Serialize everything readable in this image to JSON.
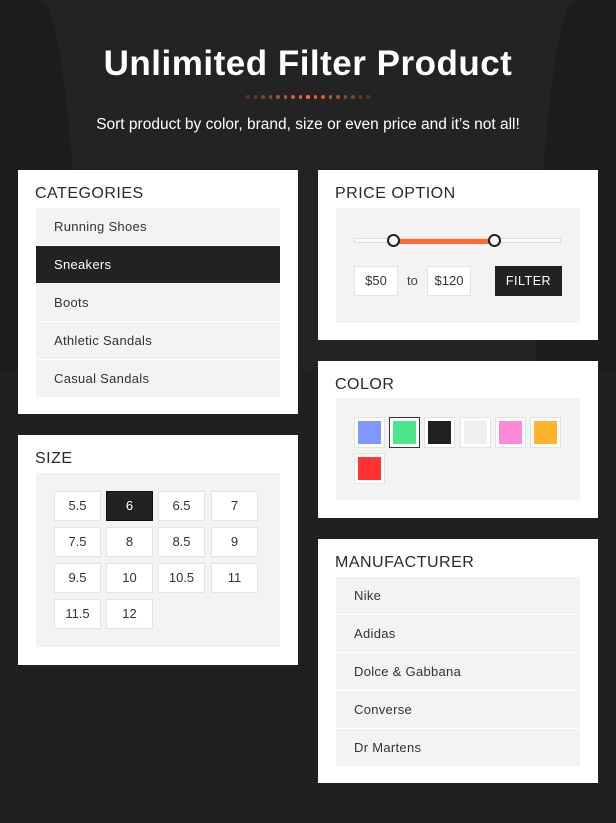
{
  "header": {
    "title": "Unlimited Filter Product",
    "subtitle": "Sort product by color, brand, size or even price and it’s not all!",
    "accent": "#ff6b2f"
  },
  "categories": {
    "title": "CATEGORIES",
    "items": [
      {
        "label": "Running Shoes",
        "active": false
      },
      {
        "label": "Sneakers",
        "active": true
      },
      {
        "label": "Boots",
        "active": false
      },
      {
        "label": "Athletic Sandals",
        "active": false
      },
      {
        "label": "Casual Sandals",
        "active": false
      }
    ]
  },
  "size": {
    "title": "SIZE",
    "items": [
      "5.5",
      "6",
      "6.5",
      "7",
      "7.5",
      "8",
      "8.5",
      "9",
      "9.5",
      "10",
      "10.5",
      "11",
      "11.5",
      "12"
    ],
    "selected": "6"
  },
  "price": {
    "title": "PRICE OPTION",
    "min": "$50",
    "to": "to",
    "max": "$120",
    "filter_label": "FILTER",
    "slider_low_fraction": 0.19,
    "slider_high_fraction": 0.68
  },
  "color": {
    "title": "COLOR",
    "swatches": [
      "#7f97ff",
      "#4ee68a",
      "#222222",
      "#efefef",
      "#ff88d8",
      "#ffb22c",
      "#ff3333"
    ],
    "selected_index": 1
  },
  "manufacturer": {
    "title": "MANUFACTURER",
    "items": [
      "Nike",
      "Adidas",
      "Dolce & Gabbana",
      "Converse",
      "Dr Martens"
    ]
  }
}
